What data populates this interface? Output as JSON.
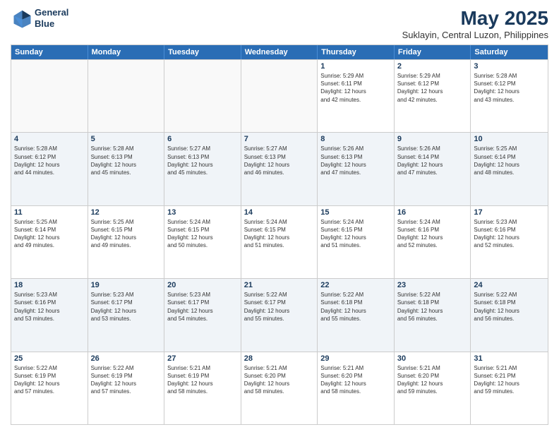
{
  "header": {
    "logo_line1": "General",
    "logo_line2": "Blue",
    "title": "May 2025",
    "subtitle": "Suklayin, Central Luzon, Philippines"
  },
  "days_of_week": [
    "Sunday",
    "Monday",
    "Tuesday",
    "Wednesday",
    "Thursday",
    "Friday",
    "Saturday"
  ],
  "weeks": [
    [
      {
        "num": "",
        "info": "",
        "empty": true
      },
      {
        "num": "",
        "info": "",
        "empty": true
      },
      {
        "num": "",
        "info": "",
        "empty": true
      },
      {
        "num": "",
        "info": "",
        "empty": true
      },
      {
        "num": "1",
        "info": "Sunrise: 5:29 AM\nSunset: 6:11 PM\nDaylight: 12 hours\nand 42 minutes.",
        "empty": false
      },
      {
        "num": "2",
        "info": "Sunrise: 5:29 AM\nSunset: 6:12 PM\nDaylight: 12 hours\nand 42 minutes.",
        "empty": false
      },
      {
        "num": "3",
        "info": "Sunrise: 5:28 AM\nSunset: 6:12 PM\nDaylight: 12 hours\nand 43 minutes.",
        "empty": false
      }
    ],
    [
      {
        "num": "4",
        "info": "Sunrise: 5:28 AM\nSunset: 6:12 PM\nDaylight: 12 hours\nand 44 minutes.",
        "empty": false
      },
      {
        "num": "5",
        "info": "Sunrise: 5:28 AM\nSunset: 6:13 PM\nDaylight: 12 hours\nand 45 minutes.",
        "empty": false
      },
      {
        "num": "6",
        "info": "Sunrise: 5:27 AM\nSunset: 6:13 PM\nDaylight: 12 hours\nand 45 minutes.",
        "empty": false
      },
      {
        "num": "7",
        "info": "Sunrise: 5:27 AM\nSunset: 6:13 PM\nDaylight: 12 hours\nand 46 minutes.",
        "empty": false
      },
      {
        "num": "8",
        "info": "Sunrise: 5:26 AM\nSunset: 6:13 PM\nDaylight: 12 hours\nand 47 minutes.",
        "empty": false
      },
      {
        "num": "9",
        "info": "Sunrise: 5:26 AM\nSunset: 6:14 PM\nDaylight: 12 hours\nand 47 minutes.",
        "empty": false
      },
      {
        "num": "10",
        "info": "Sunrise: 5:25 AM\nSunset: 6:14 PM\nDaylight: 12 hours\nand 48 minutes.",
        "empty": false
      }
    ],
    [
      {
        "num": "11",
        "info": "Sunrise: 5:25 AM\nSunset: 6:14 PM\nDaylight: 12 hours\nand 49 minutes.",
        "empty": false
      },
      {
        "num": "12",
        "info": "Sunrise: 5:25 AM\nSunset: 6:15 PM\nDaylight: 12 hours\nand 49 minutes.",
        "empty": false
      },
      {
        "num": "13",
        "info": "Sunrise: 5:24 AM\nSunset: 6:15 PM\nDaylight: 12 hours\nand 50 minutes.",
        "empty": false
      },
      {
        "num": "14",
        "info": "Sunrise: 5:24 AM\nSunset: 6:15 PM\nDaylight: 12 hours\nand 51 minutes.",
        "empty": false
      },
      {
        "num": "15",
        "info": "Sunrise: 5:24 AM\nSunset: 6:15 PM\nDaylight: 12 hours\nand 51 minutes.",
        "empty": false
      },
      {
        "num": "16",
        "info": "Sunrise: 5:24 AM\nSunset: 6:16 PM\nDaylight: 12 hours\nand 52 minutes.",
        "empty": false
      },
      {
        "num": "17",
        "info": "Sunrise: 5:23 AM\nSunset: 6:16 PM\nDaylight: 12 hours\nand 52 minutes.",
        "empty": false
      }
    ],
    [
      {
        "num": "18",
        "info": "Sunrise: 5:23 AM\nSunset: 6:16 PM\nDaylight: 12 hours\nand 53 minutes.",
        "empty": false
      },
      {
        "num": "19",
        "info": "Sunrise: 5:23 AM\nSunset: 6:17 PM\nDaylight: 12 hours\nand 53 minutes.",
        "empty": false
      },
      {
        "num": "20",
        "info": "Sunrise: 5:23 AM\nSunset: 6:17 PM\nDaylight: 12 hours\nand 54 minutes.",
        "empty": false
      },
      {
        "num": "21",
        "info": "Sunrise: 5:22 AM\nSunset: 6:17 PM\nDaylight: 12 hours\nand 55 minutes.",
        "empty": false
      },
      {
        "num": "22",
        "info": "Sunrise: 5:22 AM\nSunset: 6:18 PM\nDaylight: 12 hours\nand 55 minutes.",
        "empty": false
      },
      {
        "num": "23",
        "info": "Sunrise: 5:22 AM\nSunset: 6:18 PM\nDaylight: 12 hours\nand 56 minutes.",
        "empty": false
      },
      {
        "num": "24",
        "info": "Sunrise: 5:22 AM\nSunset: 6:18 PM\nDaylight: 12 hours\nand 56 minutes.",
        "empty": false
      }
    ],
    [
      {
        "num": "25",
        "info": "Sunrise: 5:22 AM\nSunset: 6:19 PM\nDaylight: 12 hours\nand 57 minutes.",
        "empty": false
      },
      {
        "num": "26",
        "info": "Sunrise: 5:22 AM\nSunset: 6:19 PM\nDaylight: 12 hours\nand 57 minutes.",
        "empty": false
      },
      {
        "num": "27",
        "info": "Sunrise: 5:21 AM\nSunset: 6:19 PM\nDaylight: 12 hours\nand 58 minutes.",
        "empty": false
      },
      {
        "num": "28",
        "info": "Sunrise: 5:21 AM\nSunset: 6:20 PM\nDaylight: 12 hours\nand 58 minutes.",
        "empty": false
      },
      {
        "num": "29",
        "info": "Sunrise: 5:21 AM\nSunset: 6:20 PM\nDaylight: 12 hours\nand 58 minutes.",
        "empty": false
      },
      {
        "num": "30",
        "info": "Sunrise: 5:21 AM\nSunset: 6:20 PM\nDaylight: 12 hours\nand 59 minutes.",
        "empty": false
      },
      {
        "num": "31",
        "info": "Sunrise: 5:21 AM\nSunset: 6:21 PM\nDaylight: 12 hours\nand 59 minutes.",
        "empty": false
      }
    ]
  ]
}
